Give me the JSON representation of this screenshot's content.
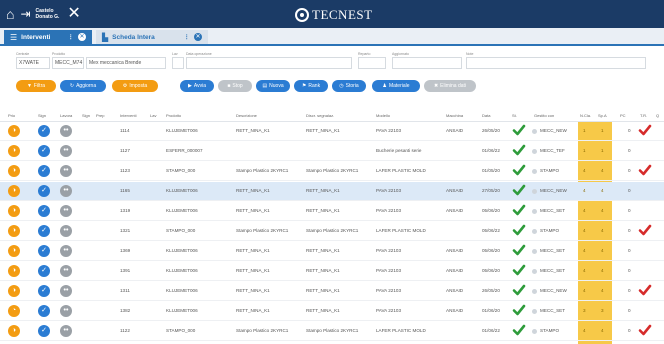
{
  "topbar": {
    "home_icon": "home-icon",
    "logout_icon": "logout-icon",
    "user_line1": "Castelo",
    "user_line2": "Donato G.",
    "close_icon": "close-icon",
    "brand": "TECNEST"
  },
  "tabs": [
    {
      "label": "Interventi",
      "icon": "list-icon"
    },
    {
      "label": "Scheda Intera",
      "icon": "chart-icon"
    }
  ],
  "filters": [
    {
      "label": "Centrale",
      "value": "X7WATE"
    },
    {
      "label": "Prodotto",
      "value": "MECC_M74"
    },
    {
      "label": "",
      "value": "Mex meccanica Brende"
    },
    {
      "label": "Lav",
      "value": ""
    },
    {
      "label": "Data operazione",
      "value": ""
    },
    {
      "label": "Reparto",
      "value": ""
    },
    {
      "label": "Aggiornato",
      "value": ""
    },
    {
      "label": "Note",
      "value": ""
    }
  ],
  "actions": [
    {
      "label": "Filtra",
      "color": "orange",
      "icon": "filter-icon"
    },
    {
      "label": "Aggiorna",
      "color": "blue",
      "icon": "refresh-icon"
    },
    {
      "label": "Imposta",
      "color": "orange",
      "icon": "settings-icon"
    },
    {
      "label": "Avvia",
      "color": "blue",
      "icon": "play-icon"
    },
    {
      "label": "Stop",
      "color": "grey",
      "icon": "stop-icon"
    },
    {
      "label": "Nuova",
      "color": "blue",
      "icon": "doc-icon"
    },
    {
      "label": "Rank",
      "color": "blue",
      "icon": "tag-icon"
    },
    {
      "label": "Storia",
      "color": "blue",
      "icon": "clock-icon"
    },
    {
      "label": "Materiale",
      "color": "blue",
      "icon": "user-icon"
    },
    {
      "label": "Elimina dati",
      "color": "grey",
      "icon": "trash-icon"
    }
  ],
  "columns": [
    "Prio",
    "Sign",
    "Lavora",
    "Sign",
    "Prep",
    "Interventi",
    "Lav",
    "Prodotto",
    "Descrizione",
    "Discr. segnalaz.",
    "Modello",
    "Macchina",
    "Data",
    "St.",
    "Gestito con",
    "N.Cla.",
    "Sp.A",
    "PC",
    "T.R.",
    "Q"
  ],
  "rows": [
    {
      "id": "1114",
      "prodotto": "KLUJEMET006",
      "desc": "RETT_NINA_K1",
      "disc": "RETT_NINA_K1",
      "modello": "PAVA 22103",
      "macchina": "ANSAID",
      "data": "26/05/20",
      "gestito": "MECC_NEW",
      "sel": false,
      "flag": true,
      "yellow": [
        "1",
        "1"
      ],
      "pc": "0"
    },
    {
      "id": "1127",
      "prodotto": "ESFERR_000007",
      "desc": "",
      "disc": "",
      "modello": "Bucherie pesanti serie",
      "macchina": "",
      "data": "01/06/22",
      "gestito": "MECC_TEF",
      "sel": false,
      "flag": false,
      "yellow": [
        "1",
        "1"
      ],
      "pc": "0"
    },
    {
      "id": "1123",
      "prodotto": "STAMPO_000",
      "desc": "Stampo Plastico 2KYRC1",
      "disc": "Stampo Plastico 2KYRC1",
      "modello": "LAFER PLASTIC MOLD",
      "macchina": "",
      "data": "01/05/20",
      "gestito": "STAMPO",
      "sel": false,
      "flag": true,
      "yellow": [
        "4",
        "4"
      ],
      "pc": "0"
    },
    {
      "id": "1165",
      "prodotto": "KLUJEMET006",
      "desc": "RETT_NINA_K1",
      "disc": "RETT_NINA_K1",
      "modello": "PAVA 22103",
      "macchina": "ANSAID",
      "data": "27/05/20",
      "gestito": "MECC_NEW",
      "sel": true,
      "flag": false,
      "yellow": [
        "4",
        "4"
      ],
      "pc": "0"
    },
    {
      "id": "1319",
      "prodotto": "KLUJEMET006",
      "desc": "RETT_NINA_K1",
      "disc": "RETT_NINA_K1",
      "modello": "PAVA 22103",
      "macchina": "ANSAID",
      "data": "05/06/20",
      "gestito": "MECC_SET",
      "sel": false,
      "flag": false,
      "yellow": [
        "4",
        "4"
      ],
      "pc": "0"
    },
    {
      "id": "1321",
      "prodotto": "STAMPO_000",
      "desc": "Stampo Plastico 2KYRC1",
      "disc": "Stampo Plastico 2KYRC1",
      "modello": "LAFER PLASTIC MOLD",
      "macchina": "",
      "data": "05/06/22",
      "gestito": "STAMPO",
      "sel": false,
      "flag": true,
      "yellow": [
        "4",
        "4"
      ],
      "pc": "0"
    },
    {
      "id": "1369",
      "prodotto": "KLUJEMET006",
      "desc": "RETT_NINA_K1",
      "disc": "RETT_NINA_K1",
      "modello": "PAVA 22103",
      "macchina": "ANSAID",
      "data": "05/06/20",
      "gestito": "MECC_SET",
      "sel": false,
      "flag": false,
      "yellow": [
        "4",
        "4"
      ],
      "pc": "0"
    },
    {
      "id": "1391",
      "prodotto": "KLUJEMET006",
      "desc": "RETT_NINA_K1",
      "disc": "RETT_NINA_K1",
      "modello": "PAVA 22103",
      "macchina": "ANSAID",
      "data": "05/06/20",
      "gestito": "MECC_SET",
      "sel": false,
      "flag": false,
      "yellow": [
        "4",
        "4"
      ],
      "pc": "0"
    },
    {
      "id": "1311",
      "prodotto": "KLUJEMET006",
      "desc": "RETT_NINA_K1",
      "disc": "RETT_NINA_K1",
      "modello": "PAVA 22103",
      "macchina": "ANSAID",
      "data": "26/05/20",
      "gestito": "MECC_NEW",
      "sel": false,
      "flag": true,
      "yellow": [
        "4",
        "4"
      ],
      "pc": "0"
    },
    {
      "id": "1382",
      "prodotto": "KLUJEMET006",
      "desc": "RETT_NINA_K1",
      "disc": "RETT_NINA_K1",
      "modello": "PAVA 22103",
      "macchina": "ANSAID",
      "data": "01/06/20",
      "gestito": "MECC_SET",
      "sel": false,
      "flag": false,
      "yellow": [
        "3",
        "3"
      ],
      "pc": "0"
    },
    {
      "id": "1122",
      "prodotto": "STAMPO_000",
      "desc": "Stampo Plastico 2KYRC1",
      "disc": "Stampo Plastico 2KYRC1",
      "modello": "LAFER PLASTIC MOLD",
      "macchina": "",
      "data": "01/06/22",
      "gestito": "STAMPO",
      "sel": false,
      "flag": true,
      "yellow": [
        "4",
        "4"
      ],
      "pc": "0"
    }
  ],
  "colors": {
    "topbar": "#1b3b66",
    "accent": "#2b73b6",
    "orange": "#f39c12",
    "green": "#2e9c3b",
    "red": "#d62b2b",
    "yellow": "#f7c948"
  }
}
